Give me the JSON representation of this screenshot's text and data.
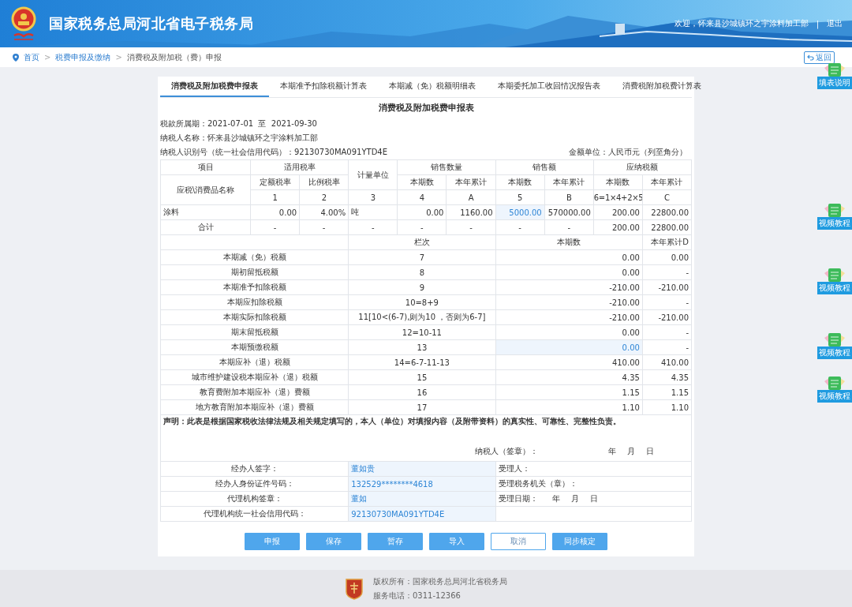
{
  "header": {
    "title": "国家税务总局河北省电子税务局",
    "welcome": "欢迎，怀来县沙城镇环之宇涂料加工部",
    "separator": "|",
    "logout": "退出"
  },
  "breadcrumb": {
    "items": [
      "首页",
      "税费申报及缴纳",
      "消费税及附加税（费）申报"
    ],
    "separator": ">",
    "back": "返回"
  },
  "tabs": [
    {
      "label": "消费税及附加税费申报表",
      "selected": true
    },
    {
      "label": "本期准予扣除税额计算表",
      "selected": false
    },
    {
      "label": "本期减（免）税额明细表",
      "selected": false
    },
    {
      "label": "本期委托加工收回情况报告表",
      "selected": false
    },
    {
      "label": "消费税附加税费计算表",
      "selected": false
    }
  ],
  "form": {
    "title": "消费税及附加税费申报表",
    "period": "税款所属期：2021-07-01  至  2021-09-30",
    "taxpayer_name": "纳税人名称：怀来县沙城镇环之宇涂料加工部",
    "taxpayer_id": "纳税人识别号（统一社会信用代码）：92130730MA091YTD4E",
    "unit": "金额单位：人民币元（列至角分）"
  },
  "main_table": {
    "header_row_1": [
      "项目",
      "适用税率",
      "计量单位",
      "销售数量",
      "销售额",
      "应纳税额"
    ],
    "header_row_2": [
      "应税\\消费品名称",
      "定额税率",
      "比例税率",
      "本期数",
      "本年累计",
      "本期数",
      "本年累计",
      "本期数",
      "本年累计"
    ],
    "index_row": [
      "1",
      "2",
      "3",
      "4",
      "A",
      "5",
      "B",
      "6=1×4+2×5",
      "C"
    ],
    "rows": [
      {
        "kind": "item",
        "cells": [
          {
            "text": "涂料",
            "editable": false
          },
          {
            "text": "0.00",
            "editable": false
          },
          {
            "text": "4.00%",
            "editable": false
          },
          {
            "text": "吨",
            "editable": false
          },
          {
            "text": "0.00",
            "editable": false
          },
          {
            "text": "1160.00",
            "editable": false
          },
          {
            "text": "5000.00",
            "editable": true
          },
          {
            "text": "570000.00",
            "editable": false
          },
          {
            "text": "200.00",
            "editable": false
          },
          {
            "text": "22800.00",
            "editable": false
          }
        ]
      },
      {
        "kind": "total",
        "cells": [
          {
            "text": "合计",
            "editable": false
          },
          {
            "text": "-",
            "editable": false
          },
          {
            "text": "-",
            "editable": false
          },
          {
            "text": "-",
            "editable": false
          },
          {
            "text": "-",
            "editable": false
          },
          {
            "text": "-",
            "editable": false
          },
          {
            "text": "-",
            "editable": false
          },
          {
            "text": "-",
            "editable": false
          },
          {
            "text": "200.00",
            "editable": false
          },
          {
            "text": "22800.00",
            "editable": false
          }
        ]
      }
    ]
  },
  "summary_table": {
    "columns": [
      "栏次",
      "本期数",
      "本年累计D"
    ],
    "rows": [
      {
        "label": "本期减（免）税额",
        "index": "7",
        "current": "0.00",
        "editable": false,
        "ytd": "0.00"
      },
      {
        "label": "期初留抵税额",
        "index": "8",
        "current": "0.00",
        "editable": false,
        "ytd": "-"
      },
      {
        "label": "本期准予扣除税额",
        "index": "9",
        "current": "-210.00",
        "editable": false,
        "ytd": "-210.00"
      },
      {
        "label": "本期应扣除税额",
        "index": "10=8+9",
        "current": "-210.00",
        "editable": false,
        "ytd": "-"
      },
      {
        "label": "本期实际扣除税额",
        "index": "11[10<(6-7),则为10 ，否则为6-7]",
        "current": "-210.00",
        "editable": false,
        "ytd": "-210.00"
      },
      {
        "label": "期末留抵税额",
        "index": "12=10-11",
        "current": "0.00",
        "editable": false,
        "ytd": "-"
      },
      {
        "label": "本期预缴税额",
        "index": "13",
        "current": "0.00",
        "editable": true,
        "ytd": "-"
      },
      {
        "label": "本期应补（退）税额",
        "index": "14=6-7-11-13",
        "current": "410.00",
        "editable": false,
        "ytd": "410.00"
      },
      {
        "label": "城市维护建设税本期应补（退）税额",
        "index": "15",
        "current": "4.35",
        "editable": false,
        "ytd": "4.35"
      },
      {
        "label": "教育费附加本期应补（退）费额",
        "index": "16",
        "current": "1.15",
        "editable": false,
        "ytd": "1.15"
      },
      {
        "label": "地方教育附加本期应补（退）费额",
        "index": "17",
        "current": "1.10",
        "editable": false,
        "ytd": "1.10"
      }
    ]
  },
  "statement": {
    "text": "声明：此表是根据国家税收法律法规及相关规定填写的，本人（单位）对填报内容（及附带资料）的真实性、可靠性、完整性负责。",
    "signature": "纳税人（签章）：",
    "date_parts": [
      "年",
      "月",
      "日"
    ]
  },
  "agent_rows": [
    {
      "label": "经办人签字：",
      "value": "董如贵",
      "right": "受理人："
    },
    {
      "label": "经办人身份证件号码：",
      "value": "132529********4618",
      "right": "受理税务机关（章）："
    },
    {
      "label": "代理机构签章：",
      "value": "董如",
      "right": "受理日期：",
      "date_parts": [
        "年",
        "月",
        "日"
      ]
    },
    {
      "label": "代理机构统一社会信用代码：",
      "value": "92130730MA091YTD4E"
    }
  ],
  "buttons": [
    {
      "label": "申报",
      "kind": "primary"
    },
    {
      "label": "保存",
      "kind": "primary"
    },
    {
      "label": "暂存",
      "kind": "primary"
    },
    {
      "label": "导入",
      "kind": "primary"
    },
    {
      "label": "取消",
      "kind": "outline"
    },
    {
      "label": "同步核定",
      "kind": "primary"
    }
  ],
  "side_buttons": [
    "填表说明",
    "视频教程",
    "视频教程",
    "视频教程",
    "视频教程"
  ],
  "footer": {
    "copyright": "版权所有：国家税务总局河北省税务局",
    "phone": "服务电话：0311-12366"
  }
}
